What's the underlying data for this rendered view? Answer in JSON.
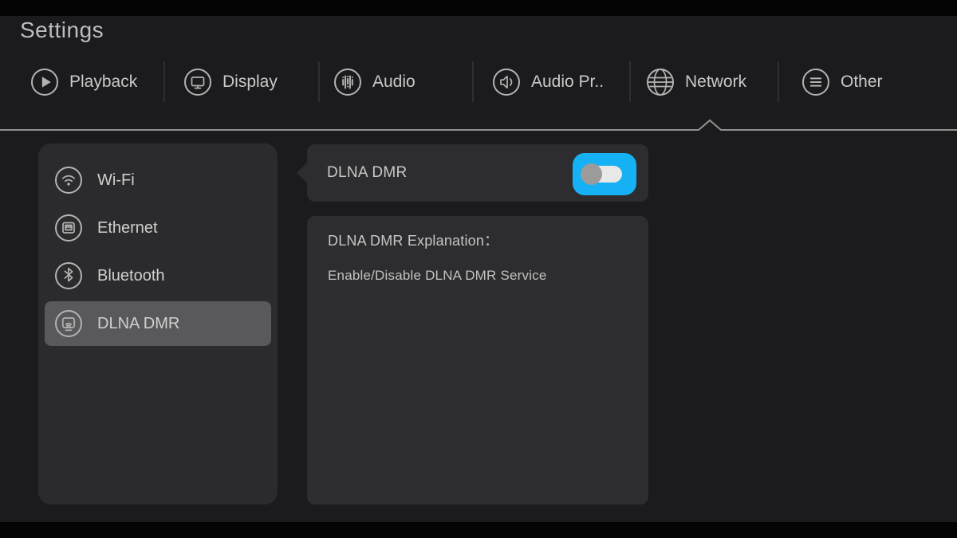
{
  "app": {
    "title": "Settings"
  },
  "tabs": [
    {
      "label": "Playback",
      "icon": "play-circle-icon",
      "selected": false
    },
    {
      "label": "Display",
      "icon": "display-circle-icon",
      "selected": false
    },
    {
      "label": "Audio",
      "icon": "equalizer-circle-icon",
      "selected": false
    },
    {
      "label": "Audio Pr..",
      "icon": "speaker-circle-icon",
      "selected": false
    },
    {
      "label": "Network",
      "icon": "globe-icon",
      "selected": true
    },
    {
      "label": "Other",
      "icon": "list-circle-icon",
      "selected": false
    }
  ],
  "sidebar": {
    "items": [
      {
        "label": "Wi-Fi",
        "icon": "wifi-icon",
        "selected": false
      },
      {
        "label": "Ethernet",
        "icon": "ethernet-icon",
        "selected": false
      },
      {
        "label": "Bluetooth",
        "icon": "bluetooth-icon",
        "selected": false
      },
      {
        "label": "DLNA DMR",
        "icon": "dlna-cast-icon",
        "selected": true
      }
    ]
  },
  "main": {
    "setting_row": {
      "label": "DLNA DMR",
      "toggle": {
        "state": "off",
        "focused": true
      }
    },
    "explanation": {
      "title": "DLNA DMR Explanation：",
      "body": "Enable/Disable DLNA DMR Service"
    }
  },
  "colors": {
    "background": "#1b1b1d",
    "panel": "#2d2d2f",
    "selected_item": "#59595c",
    "accent_blue": "#16b1f5",
    "toggle_track": "#e8e8e8",
    "toggle_thumb": "#9b9b9b",
    "text": "#c9c9c9",
    "divider_line": "#909090"
  }
}
